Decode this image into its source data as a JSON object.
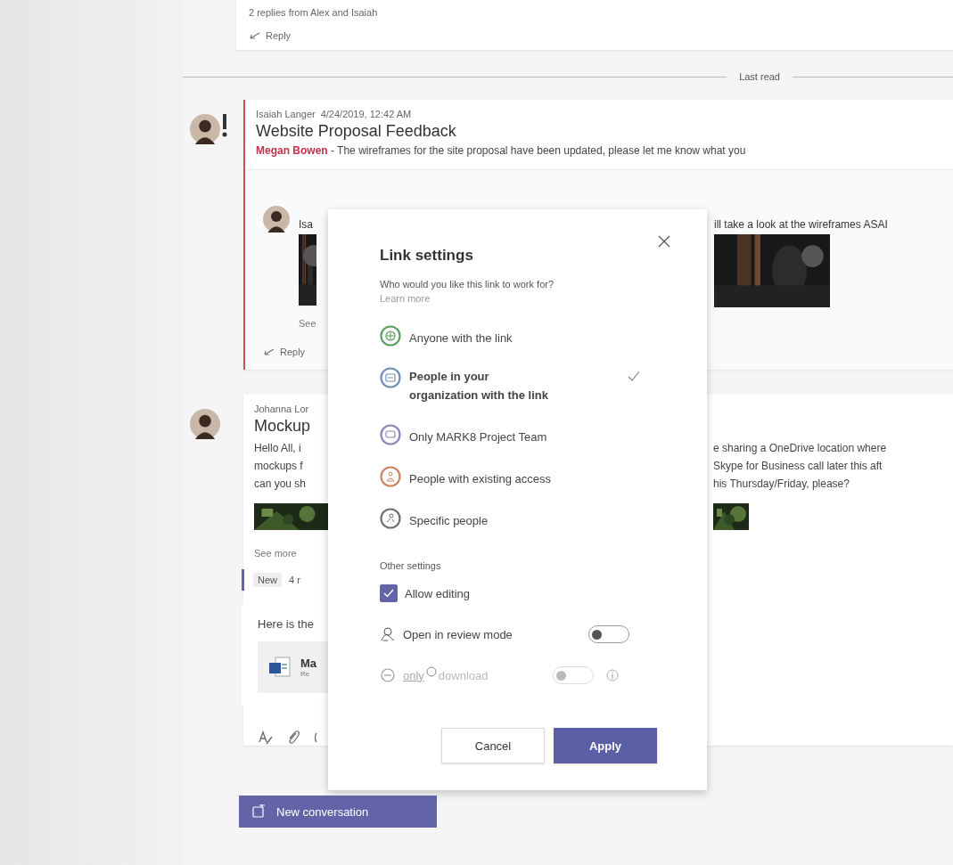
{
  "thread_top": {
    "summary": "2 replies from Alex and Isaiah",
    "reply": "Reply"
  },
  "divider": {
    "label": "Last read"
  },
  "post": {
    "important": true,
    "author": "Isaiah Langer",
    "time": "4/24/2019, 12:42 AM",
    "subject": "Website Proposal Feedback",
    "preview": "**Megan Bowen** - The wireframes for the site proposal have been updated, please let me know what you",
    "reply": {
      "left": "Isa",
      "right": "ill take a look at the wireframes ASAI",
      "see": "See",
      "action": "Reply"
    }
  },
  "post2": {
    "author": "Johanna Lor",
    "subject": "Mockup",
    "lines": [
      {
        "left": "Hello All, i",
        "right": "e sharing a OneDrive location where"
      },
      {
        "left": "mockups f",
        "right": "Skype for Business call later this aft"
      },
      {
        "left": "can you sh",
        "right": "his Thursday/Friday, please?"
      }
    ],
    "see_more": "See more",
    "badge": "New",
    "count": "4 r",
    "draft": "Here is the",
    "file": {
      "name": "Ma",
      "sub": "Re"
    }
  },
  "new_conversation": "New conversation",
  "dialog": {
    "title": "Link settings",
    "prompt": "Who would you like this link to work for?",
    "learn_more": "Learn more",
    "options": [
      {
        "kind": "globe",
        "label": "Anyone with the link",
        "color": "#5b9e5f",
        "selected": false
      },
      {
        "kind": "org",
        "label": "People in your organization with the link",
        "color": "#6f8fb8",
        "selected": true
      },
      {
        "kind": "team",
        "label": "Only MARK8 Project Team",
        "color": "#8a88b8",
        "selected": false
      },
      {
        "kind": "people",
        "label": "People with existing access",
        "color": "#c9835f",
        "selected": false
      },
      {
        "kind": "person",
        "label": "Specific people",
        "color": "#707070",
        "selected": false
      }
    ],
    "other_title": "Other settings",
    "settings": [
      {
        "kind": "checkbox",
        "label": "Allow editing",
        "checked": true
      },
      {
        "kind": "toggle",
        "label": "Open in review mode",
        "on": false,
        "disabled": false,
        "info": false
      },
      {
        "kind": "toggle",
        "label": "only",
        "faded": "download",
        "on": false,
        "disabled": true,
        "info": true
      }
    ],
    "buttons": [
      {
        "label": "Cancel",
        "primary": false
      },
      {
        "label": "Apply",
        "primary": true
      }
    ]
  }
}
